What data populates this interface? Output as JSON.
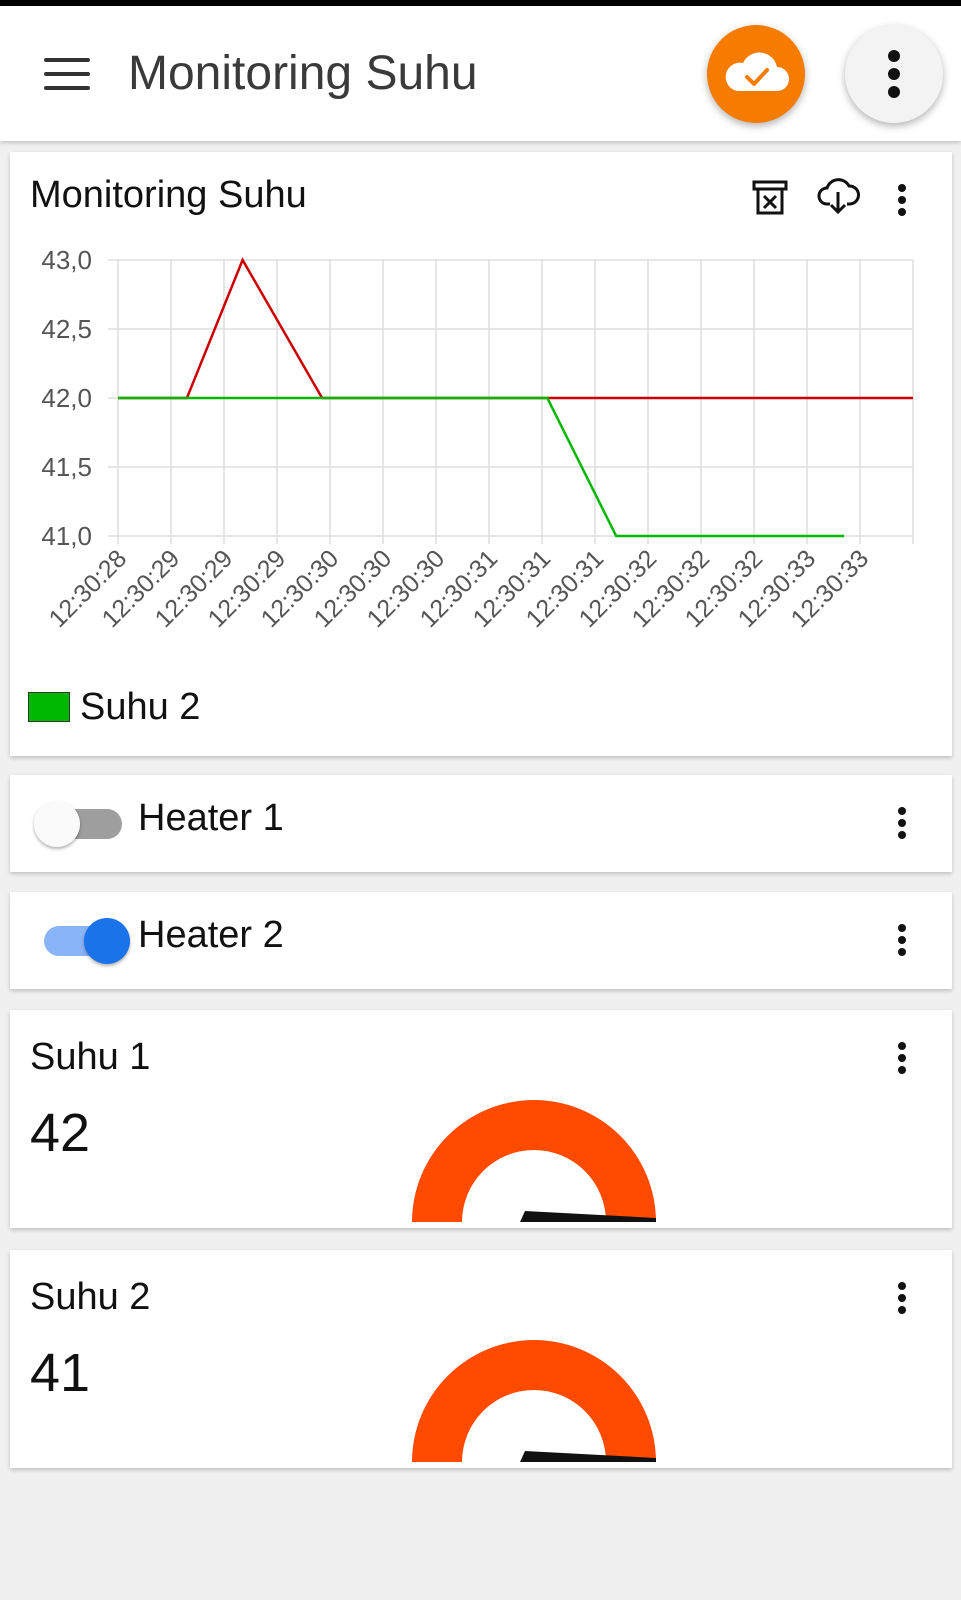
{
  "app": {
    "title": "Monitoring Suhu"
  },
  "chart_card": {
    "title": "Monitoring Suhu",
    "legend_label": "Suhu 2"
  },
  "chart_data": {
    "type": "line",
    "x": [
      "12:30:28",
      "12:30:29",
      "12:30:29",
      "12:30:29",
      "12:30:30",
      "12:30:30",
      "12:30:30",
      "12:30:31",
      "12:30:31",
      "12:30:31",
      "12:30:32",
      "12:30:32",
      "12:30:32",
      "12:30:33",
      "12:30:33"
    ],
    "ylim": [
      41.0,
      43.0
    ],
    "yticks": [
      "43,0",
      "42,5",
      "42,0",
      "41,5",
      "41,0"
    ],
    "ytick_values": [
      43.0,
      42.5,
      42.0,
      41.5,
      41.0
    ],
    "grid": true,
    "legend_position": "bottom-left",
    "series": [
      {
        "color": "#cc0000",
        "points": [
          [
            0,
            42.0
          ],
          [
            1.3,
            42.0
          ],
          [
            2.35,
            43.0
          ],
          [
            3.85,
            42.0
          ],
          [
            5,
            42.0
          ],
          [
            10,
            42.0
          ],
          [
            15,
            42.0
          ]
        ]
      },
      {
        "name": "Suhu 2",
        "color": "#00b800",
        "points": [
          [
            0,
            42.0
          ],
          [
            3.85,
            42.0
          ],
          [
            8.1,
            42.0
          ],
          [
            9.4,
            41.0
          ],
          [
            13.7,
            41.0
          ]
        ]
      }
    ]
  },
  "switches": [
    {
      "label": "Heater 1",
      "on": false
    },
    {
      "label": "Heater 2",
      "on": true
    }
  ],
  "gauges": [
    {
      "title": "Suhu 1",
      "value": "42"
    },
    {
      "title": "Suhu 2",
      "value": "41"
    }
  ],
  "colors": {
    "accent_orange": "#f57c00",
    "gauge_orange": "#ff4a00",
    "switch_blue": "#1a73e8",
    "series1": "#cc0000",
    "series2": "#00b800"
  }
}
